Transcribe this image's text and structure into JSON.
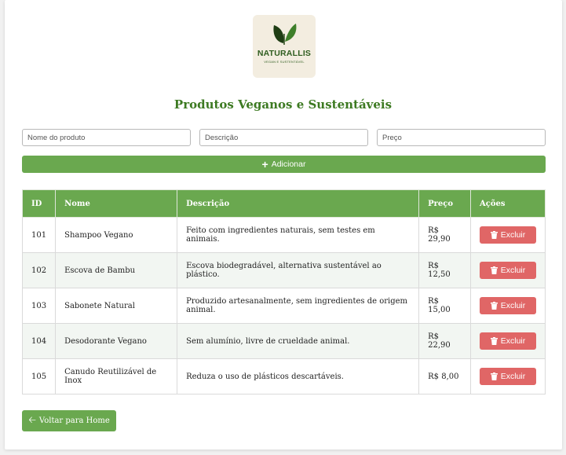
{
  "brand": {
    "name": "NATURALLIS",
    "tagline": "VEGAN E SUSTENTÁVEL"
  },
  "page": {
    "title": "Produtos Veganos e Sustentáveis"
  },
  "form": {
    "name_placeholder": "Nome do produto",
    "desc_placeholder": "Descrição",
    "price_placeholder": "Preço",
    "add_label": "Adicionar",
    "add_icon": "plus-icon"
  },
  "table": {
    "headers": [
      "ID",
      "Nome",
      "Descrição",
      "Preço",
      "Ações"
    ],
    "rows": [
      {
        "id": "101",
        "name": "Shampoo Vegano",
        "desc": "Feito com ingredientes naturais, sem testes em animais.",
        "price": "R$ 29,90",
        "action": "Excluir"
      },
      {
        "id": "102",
        "name": "Escova de Bambu",
        "desc": "Escova biodegradável, alternativa sustentável ao plástico.",
        "price": "R$ 12,50",
        "action": "Excluir"
      },
      {
        "id": "103",
        "name": "Sabonete Natural",
        "desc": "Produzido artesanalmente, sem ingredientes de origem animal.",
        "price": "R$ 15,00",
        "action": "Excluir"
      },
      {
        "id": "104",
        "name": "Desodorante Vegano",
        "desc": "Sem alumínio, livre de crueldade animal.",
        "price": "R$ 22,90",
        "action": "Excluir"
      },
      {
        "id": "105",
        "name": "Canudo Reutilizável de Inox",
        "desc": "Reduza o uso de plásticos descartáveis.",
        "price": "R$ 8,00",
        "action": "Excluir"
      }
    ],
    "delete_icon": "trash-icon"
  },
  "footer": {
    "back_label": "Voltar para Home",
    "back_icon": "arrow-left-icon"
  },
  "colors": {
    "primary_green": "#6aa84f",
    "title_green": "#3d7a22",
    "danger_red": "#e06666"
  }
}
